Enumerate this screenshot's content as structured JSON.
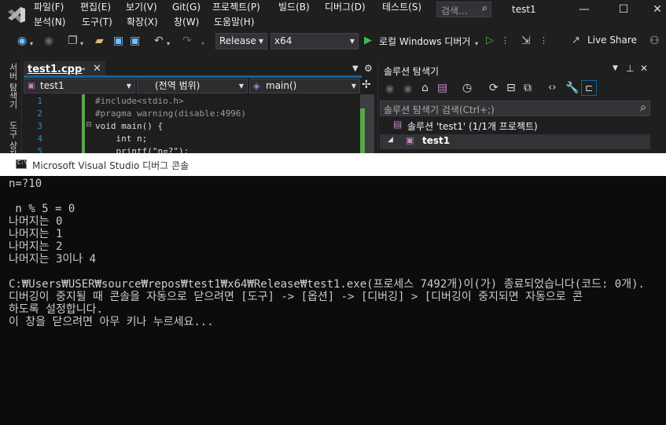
{
  "titlebar": {
    "menu_row1": [
      "파일(F)",
      "편집(E)",
      "보기(V)",
      "Git(G)",
      "프로젝트(P)",
      "빌드(B)",
      "디버그(D)",
      "테스트(S)"
    ],
    "menu_row2": [
      "분석(N)",
      "도구(T)",
      "확장(X)",
      "창(W)",
      "도움말(H)"
    ],
    "search_placeholder": "검색...",
    "window_title": "test1"
  },
  "toolbar": {
    "configuration": "Release",
    "platform": "x64",
    "run_label": "로컬 Windows 디버거",
    "live_share": "Live Share"
  },
  "left_rail": [
    "서버 탐색기",
    "도구 상자"
  ],
  "editor": {
    "tab_label": "test1.cpp",
    "nav_project": "test1",
    "nav_scope": "(전역 범위)",
    "nav_member": "main()",
    "lines": [
      {
        "n": "1",
        "text": "#include<stdio.h>"
      },
      {
        "n": "2",
        "text": "#pragma warning(disable:4996)"
      },
      {
        "n": "3",
        "text": "void main() {"
      },
      {
        "n": "4",
        "text": "    int n;"
      },
      {
        "n": "5",
        "text": "    printf(\"n=?\");"
      }
    ]
  },
  "solution_explorer": {
    "title": "솔루션 탐색기",
    "search_placeholder": "솔루션 탐색기 검색(Ctrl+;)",
    "root_label": "솔루션 'test1' (1/1개 프로젝트)",
    "project_label": "test1"
  },
  "console": {
    "title": "Microsoft Visual Studio 디버그 콘솔",
    "lines": [
      "n=?10",
      "",
      " n % 5 = 0",
      "나머지는 0",
      "나머지는 1",
      "나머지는 2",
      "나머지는 3이나 4",
      "",
      "C:₩Users₩USER₩source₩repos₩test1₩x64₩Release₩test1.exe(프로세스 7492개)이(가) 종료되었습니다(코드: 0개).",
      "디버깅이 중지될 때 콘솔을 자동으로 닫으려면 [도구] -> [옵션] -> [디버깅] > [디버깅이 중지되면 자동으로 콘",
      "하도록 설정합니다.",
      "이 창을 닫으려면 아무 키나 누르세요..."
    ]
  },
  "colors": {
    "accent": "#0e639c",
    "vs_purple": "#68217a",
    "keyword": "#569cd6",
    "string": "#d69d85",
    "preprocessor": "#9b9b9b",
    "run_green": "#3fb950"
  }
}
